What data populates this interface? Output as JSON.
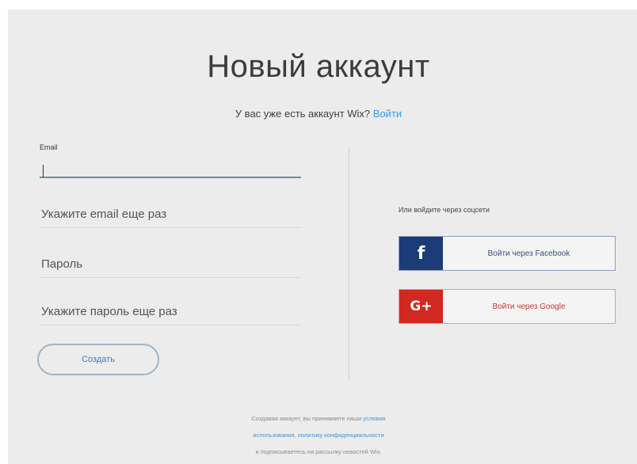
{
  "header": {
    "title": "Новый аккаунт",
    "subtitle_text": "У вас уже есть аккаунт Wix?",
    "login_link": "Войти"
  },
  "form": {
    "email_label": "Email",
    "email_value": "",
    "email_confirm_placeholder": "Укажите email еще раз",
    "password_placeholder": "Пароль",
    "password_confirm_placeholder": "Укажите пароль еще раз",
    "create_button": "Создать"
  },
  "social": {
    "heading": "Или войдите через соцсети",
    "facebook_icon": "f",
    "facebook_label": "Войти через Facebook",
    "google_icon": "G+",
    "google_label": "Войти через Google",
    "facebook_color": "#1b3c77",
    "google_color": "#d1281f"
  },
  "terms": {
    "line1_text": "Создавая аккаунт, вы принимаете наши",
    "line1_link": "условия",
    "line2_link_a": "использования",
    "line2_sep": ",",
    "line2_link_b": "политику конфиденциальности",
    "line3_text": "и подписываетесь на рассылку новостей Wix."
  },
  "colors": {
    "accent": "#3899ec",
    "background": "#ececec"
  }
}
